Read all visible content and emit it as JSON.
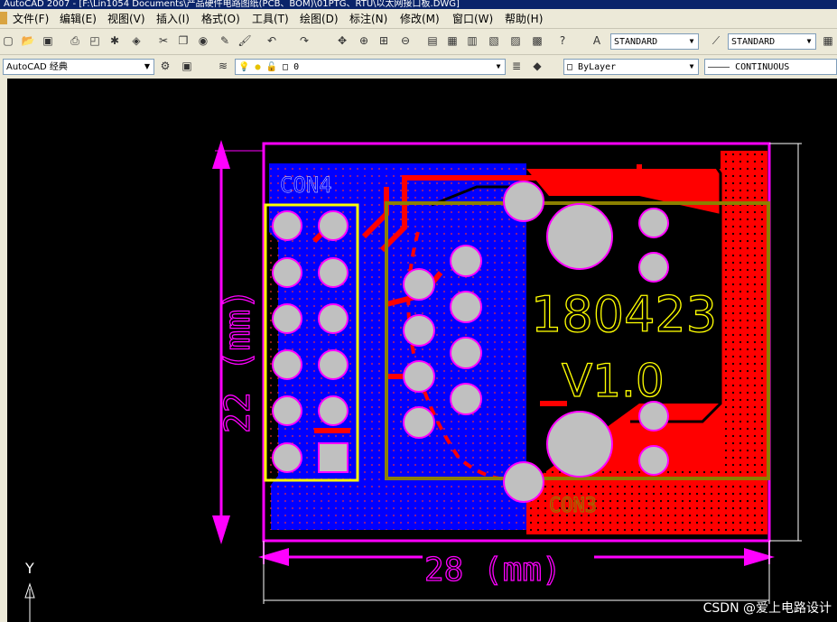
{
  "window": {
    "title": "AutoCAD 2007 - [F:\\Lin1054 Documents\\产品硬件电路图纸(PCB、BOM)\\01PTG、RTU\\以太网接口板.DWG]"
  },
  "menu": [
    "文件(F)",
    "编辑(E)",
    "视图(V)",
    "插入(I)",
    "格式(O)",
    "工具(T)",
    "绘图(D)",
    "标注(N)",
    "修改(M)",
    "窗口(W)",
    "帮助(H)"
  ],
  "toolbar": {
    "text_style": "STANDARD",
    "dim_style": "STANDARD",
    "workspace": "AutoCAD 经典",
    "layer": "0",
    "color": "ByLayer",
    "linetype": "CONTINUOUS"
  },
  "icons": [
    "new-icon",
    "open-icon",
    "save-icon",
    "print-icon",
    "preview-icon",
    "publish-icon",
    "3d-icon",
    "cut-icon",
    "copy-icon",
    "paste-icon",
    "match-icon",
    "brush-icon",
    "undo-icon",
    "redo-icon",
    "pan-icon",
    "zoom-realtime-icon",
    "zoom-window-icon",
    "zoom-prev-icon",
    "properties-icon",
    "design-center-icon",
    "tool-palette-icon",
    "sheetset-icon",
    "markup-icon",
    "calc-icon",
    "help-icon",
    "text-style-icon",
    "dim-style-icon",
    "layer-manager-icon",
    "layer-state-icon"
  ],
  "drawing": {
    "connector_left_label": "CON4",
    "connector_right_label": "CON3",
    "date_label": "180423",
    "version_label": "V1.0",
    "height_dim": "22 (mm)",
    "width_dim": "28 (mm)",
    "ucs_y": "Y",
    "colors": {
      "outline": "#ff00ff",
      "top_copper": "#ff0000",
      "bottom_copper": "#0000ff",
      "con4_box": "#ffff00",
      "con3_box": "#8b8000",
      "pad": "#c0c0c0",
      "text": "#ffff00"
    }
  },
  "watermark": "CSDN @爱上电路设计"
}
